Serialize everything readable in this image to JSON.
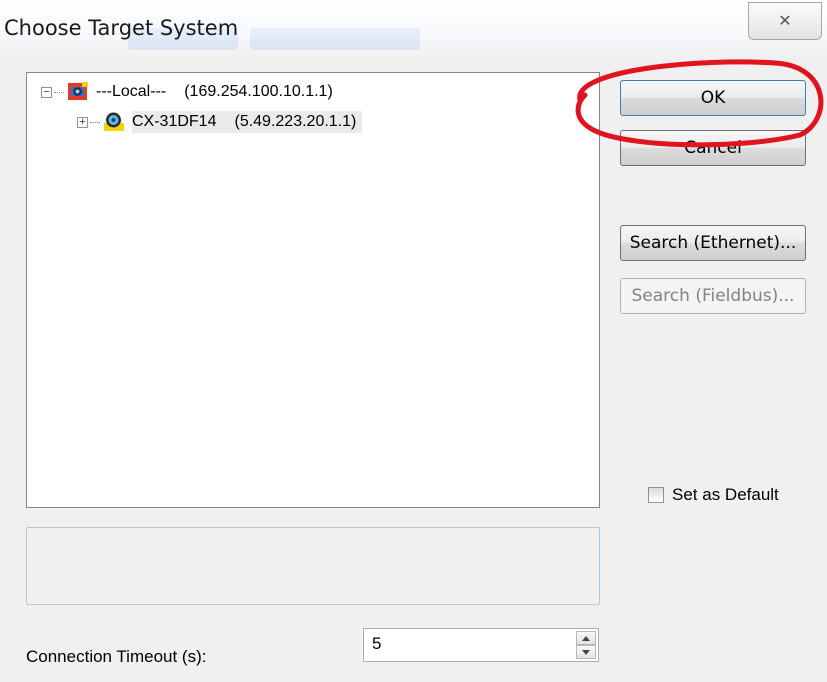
{
  "window": {
    "title": "Choose Target System",
    "close_glyph": "✕"
  },
  "tree": {
    "nodes": [
      {
        "expander": "−",
        "name": "---Local---",
        "address": "(169.254.100.10.1.1)",
        "icon": "network-router-icon"
      },
      {
        "expander": "+",
        "name": "CX-31DF14",
        "address": "(5.49.223.20.1.1)",
        "icon": "network-router-icon"
      }
    ]
  },
  "buttons": {
    "ok": "OK",
    "cancel": "Cancel",
    "search_ethernet": "Search (Ethernet)...",
    "search_fieldbus": "Search (Fieldbus)..."
  },
  "set_default": {
    "label": "Set as Default",
    "checked": false
  },
  "connection_timeout": {
    "label": "Connection Timeout (s):",
    "value": "5"
  },
  "colors": {
    "highlight_ellipse": "#e0141e",
    "ok_border": "#3c7fb1"
  }
}
